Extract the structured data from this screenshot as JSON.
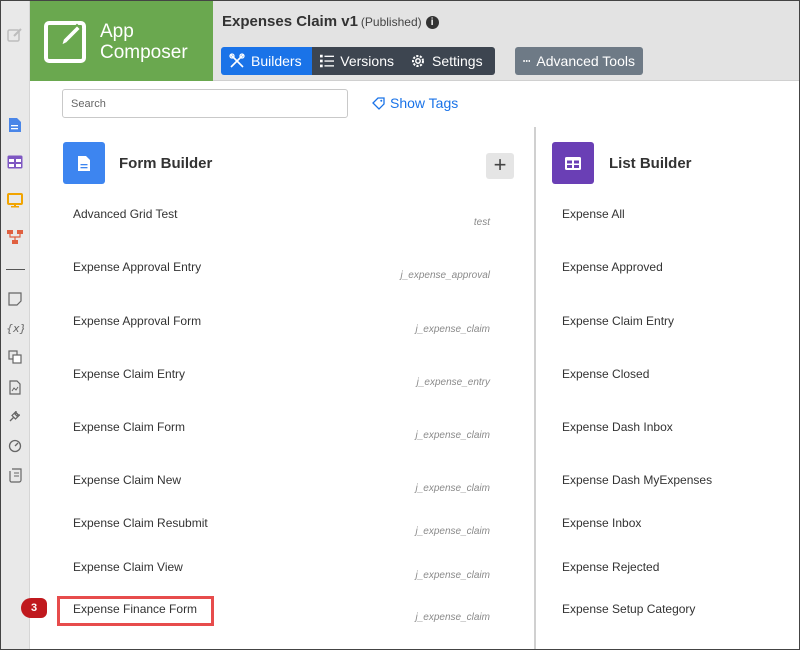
{
  "brand": {
    "line1": "App",
    "line2": "Composer"
  },
  "app": {
    "title": "Expenses Claim v1",
    "status": "(Published)",
    "info_icon": "i"
  },
  "toolbar": {
    "builders_label": "Builders",
    "versions_label": "Versions",
    "settings_label": "Settings",
    "advanced_label": "Advanced Tools"
  },
  "search": {
    "placeholder": "Search",
    "show_tags_label": "Show Tags"
  },
  "form_builder": {
    "title": "Form Builder",
    "add_symbol": "+",
    "items": [
      {
        "name": "Advanced Grid Test",
        "tag": "test"
      },
      {
        "name": "Expense Approval Entry",
        "tag": "j_expense_approval"
      },
      {
        "name": "Expense Approval Form",
        "tag": "j_expense_claim"
      },
      {
        "name": "Expense Claim Entry",
        "tag": "j_expense_entry"
      },
      {
        "name": "Expense Claim Form",
        "tag": "j_expense_claim"
      },
      {
        "name": "Expense Claim New",
        "tag": "j_expense_claim"
      },
      {
        "name": "Expense Claim Resubmit",
        "tag": "j_expense_claim"
      },
      {
        "name": "Expense Claim View",
        "tag": "j_expense_claim"
      },
      {
        "name": "Expense Finance Form",
        "tag": "j_expense_claim"
      }
    ]
  },
  "list_builder": {
    "title": "List Builder",
    "items": [
      "Expense All",
      "Expense Approved",
      "Expense Claim Entry",
      "Expense Closed",
      "Expense Dash Inbox",
      "Expense Dash MyExpenses",
      "Expense Inbox",
      "Expense Rejected",
      "Expense Setup Category"
    ]
  },
  "annotation": {
    "step": "3"
  },
  "colors": {
    "brand_green": "#6aa84f",
    "primary_blue": "#1a73e8",
    "dark_button": "#3d4550",
    "list_purple": "#6a3fb5",
    "highlight_red": "#e74c4c"
  }
}
